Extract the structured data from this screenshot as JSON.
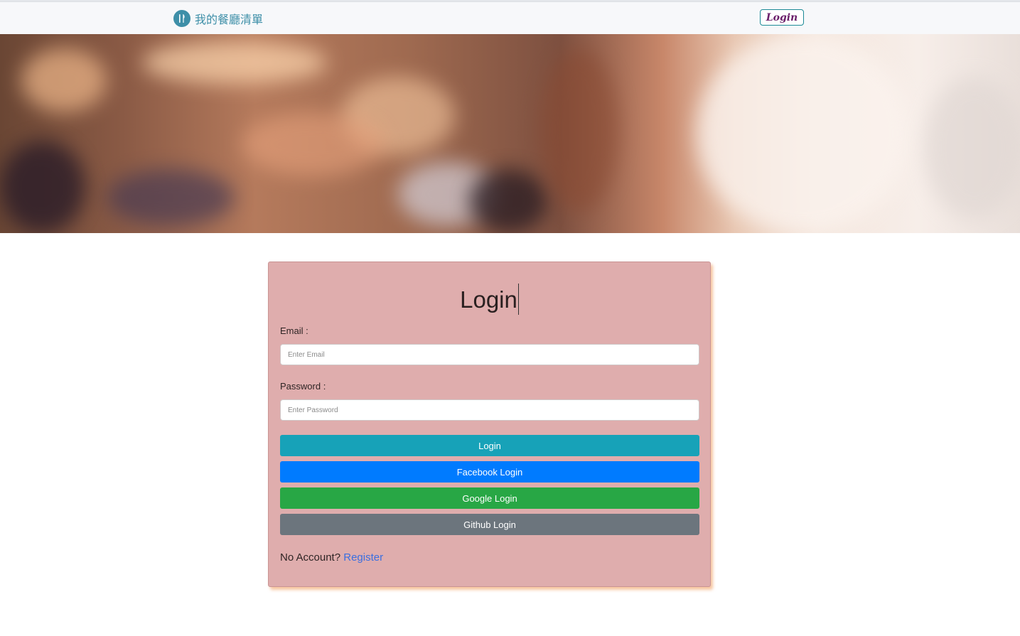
{
  "navbar": {
    "brand_icon": "fork-knife-icon",
    "brand_text": "我的餐廳清單",
    "login_label": "Login",
    "accent_color": "#3e8fa8"
  },
  "banner": {
    "description": "blurred restaurant interior photo"
  },
  "login_form": {
    "title": "Login",
    "email_label": "Email :",
    "email_placeholder": "Enter Email",
    "email_value": "",
    "password_label": "Password :",
    "password_placeholder": "Enter Password",
    "password_value": "",
    "buttons": {
      "login": "Login",
      "facebook": "Facebook Login",
      "google": "Google Login",
      "github": "Github Login"
    },
    "no_account_text": "No Account?",
    "register_link": "Register"
  },
  "colors": {
    "card_bg": "#dfadad",
    "login_btn": "#17a2b8",
    "facebook_btn": "#007bff",
    "google_btn": "#28a745",
    "github_btn": "#6c757d",
    "link": "#3b6fe0"
  }
}
